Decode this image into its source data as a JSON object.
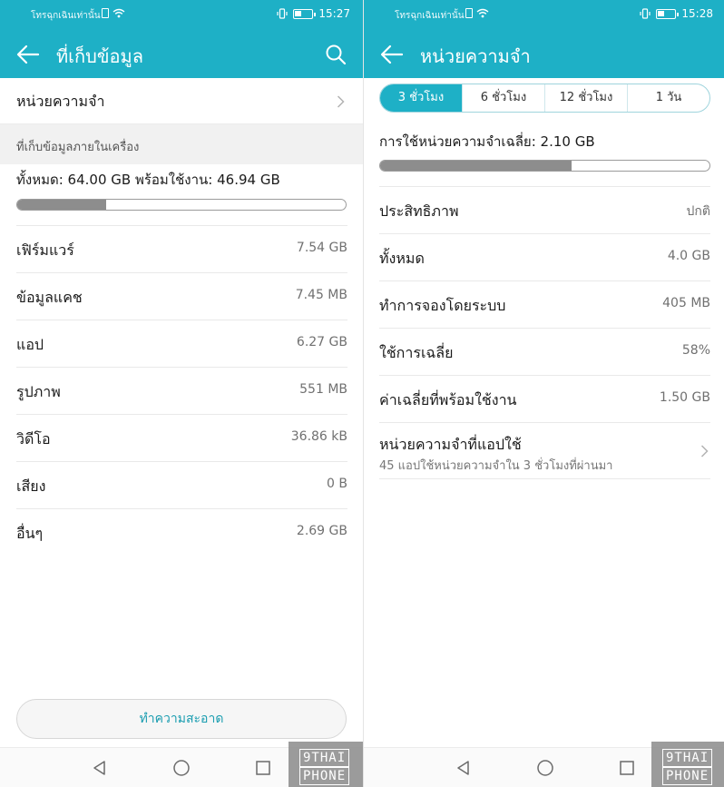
{
  "status_left": {
    "carrier": "โทรฉุกเฉินเท่านั้น",
    "time": "15:27"
  },
  "status_right": {
    "carrier": "โทรฉุกเฉินเท่านั้น",
    "time": "15:28"
  },
  "storage": {
    "title": "ที่เก็บข้อมูล",
    "memory_row": "หน่วยความจำ",
    "section": "ที่เก็บข้อมูลภายในเครื่อง",
    "total_line": "ทั้งหมด: 64.00 GB พร้อมใช้งาน: 46.94 GB",
    "used_fraction": 0.27,
    "items": [
      {
        "name": "เฟิร์มแวร์",
        "value": "7.54 GB"
      },
      {
        "name": "ข้อมูลแคช",
        "value": "7.45 MB"
      },
      {
        "name": "แอป",
        "value": "6.27 GB"
      },
      {
        "name": "รูปภาพ",
        "value": "551 MB"
      },
      {
        "name": "วิดีโอ",
        "value": "36.86 kB"
      },
      {
        "name": "เสียง",
        "value": "0 B"
      },
      {
        "name": "อื่นๆ",
        "value": "2.69 GB"
      }
    ],
    "clean_button": "ทำความสะอาด"
  },
  "memory": {
    "title": "หน่วยความจำ",
    "tabs": [
      "3 ชั่วโมง",
      "6 ชั่วโมง",
      "12 ชั่วโมง",
      "1 วัน"
    ],
    "active_tab": 0,
    "avg_line": "การใช้หน่วยความจำเฉลี่ย: 2.10 GB",
    "used_fraction": 0.58,
    "items": [
      {
        "name": "ประสิทธิภาพ",
        "value": "ปกติ"
      },
      {
        "name": "ทั้งหมด",
        "value": "4.0 GB"
      },
      {
        "name": "ทำการจองโดยระบบ",
        "value": "405 MB"
      },
      {
        "name": "ใช้การเฉลี่ย",
        "value": "58%"
      },
      {
        "name": "ค่าเฉลี่ยที่พร้อมใช้งาน",
        "value": "1.50 GB"
      }
    ],
    "apps_row": {
      "name": "หน่วยความจำที่แอปใช้",
      "sub": "45 แอปใช้หน่วยความจำใน 3 ชั่วโมงที่ผ่านมา"
    }
  },
  "watermark": {
    "line1": "9THAI",
    "line2": "PHONE"
  },
  "colors": {
    "accent": "#1eb0c6",
    "bar_fill": "#8d8d8d",
    "link": "#1a9db0"
  }
}
